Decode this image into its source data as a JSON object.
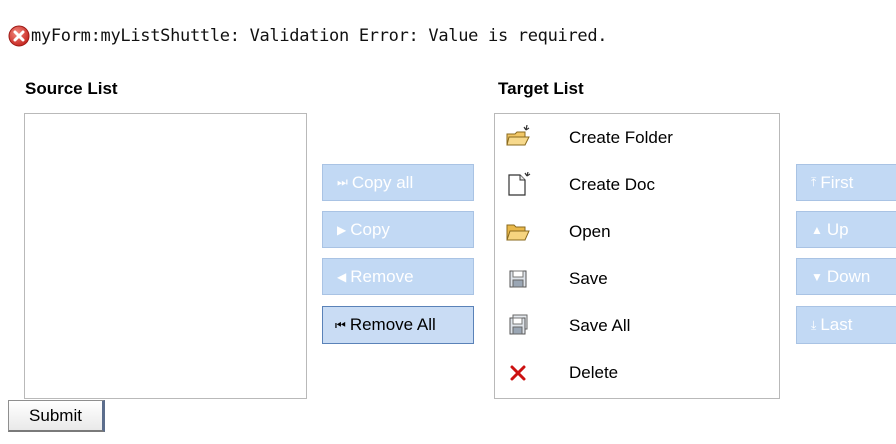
{
  "error": {
    "icon": "error-circle-icon",
    "message": "myForm:myListShuttle: Validation Error: Value is required."
  },
  "source_list": {
    "label": "Source List",
    "items": []
  },
  "target_list": {
    "label": "Target List",
    "items": [
      {
        "label": "Create Folder",
        "icon": "new-folder-icon"
      },
      {
        "label": "Create Doc",
        "icon": "new-document-icon"
      },
      {
        "label": "Open",
        "icon": "open-folder-icon"
      },
      {
        "label": "Save",
        "icon": "floppy-save-icon"
      },
      {
        "label": "Save All",
        "icon": "floppy-save-all-icon"
      },
      {
        "label": "Delete",
        "icon": "red-x-delete-icon"
      }
    ]
  },
  "shuttle_buttons": {
    "copy_all": {
      "label": "Copy all",
      "enabled": false
    },
    "copy": {
      "label": "Copy",
      "enabled": false
    },
    "remove": {
      "label": "Remove",
      "enabled": false
    },
    "remove_all": {
      "label": "Remove All",
      "enabled": true
    }
  },
  "order_buttons": {
    "first": {
      "label": "First",
      "enabled": false
    },
    "up": {
      "label": "Up",
      "enabled": false
    },
    "down": {
      "label": "Down",
      "enabled": false
    },
    "last": {
      "label": "Last",
      "enabled": false
    }
  },
  "submit": {
    "label": "Submit"
  },
  "colors": {
    "button_disabled_bg": "#c2d9f4",
    "button_disabled_text": "#ffffff",
    "error_red": "#d9342b",
    "delete_red": "#cc1111"
  }
}
